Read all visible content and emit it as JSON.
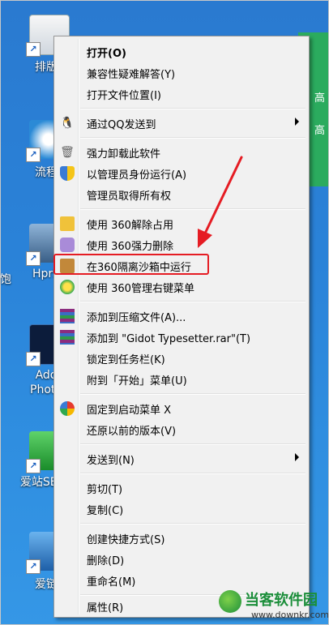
{
  "desktop": {
    "icons": [
      {
        "label": "排版"
      },
      {
        "label": "流程"
      },
      {
        "label": "HprS"
      },
      {
        "label": "Ado Photo"
      },
      {
        "label": "爱站SE 包"
      },
      {
        "label": "爱链"
      }
    ],
    "left_edge_text": "饱",
    "right_panel_text": [
      "高",
      "高"
    ]
  },
  "context_menu": {
    "items": [
      {
        "label": "打开(O)",
        "icon": "",
        "bold": true
      },
      {
        "label": "兼容性疑难解答(Y)",
        "icon": ""
      },
      {
        "label": "打开文件位置(I)",
        "icon": ""
      },
      {
        "label": "通过QQ发送到",
        "icon": "qq-penguin-icon",
        "submenu": true
      },
      {
        "label": "强力卸载此软件",
        "icon": "trash-icon"
      },
      {
        "label": "以管理员身份运行(A)",
        "icon": "uac-shield-icon"
      },
      {
        "label": "管理员取得所有权",
        "icon": ""
      },
      {
        "label": "使用 360解除占用",
        "icon": "360-unlock-icon"
      },
      {
        "label": "使用 360强力删除",
        "icon": "360-delete-icon"
      },
      {
        "label": "在360隔离沙箱中运行",
        "icon": "360-sandbox-icon"
      },
      {
        "label": "使用 360管理右键菜单",
        "icon": "360-menu-icon"
      },
      {
        "label": "添加到压缩文件(A)...",
        "icon": "winrar-icon"
      },
      {
        "label": "添加到 \"Gidot Typesetter.rar\"(T)",
        "icon": "winrar-icon"
      },
      {
        "label": "锁定到任务栏(K)",
        "icon": ""
      },
      {
        "label": "附到「开始」菜单(U)",
        "icon": ""
      },
      {
        "label": "固定到启动菜单 X",
        "icon": "pin-start-icon"
      },
      {
        "label": "还原以前的版本(V)",
        "icon": ""
      },
      {
        "label": "发送到(N)",
        "icon": "",
        "submenu": true
      },
      {
        "label": "剪切(T)",
        "icon": ""
      },
      {
        "label": "复制(C)",
        "icon": ""
      },
      {
        "label": "创建快捷方式(S)",
        "icon": ""
      },
      {
        "label": "删除(D)",
        "icon": ""
      },
      {
        "label": "重命名(M)",
        "icon": ""
      },
      {
        "label": "属性(R)",
        "icon": ""
      }
    ]
  },
  "annotation": {
    "highlight_color": "#e51c23"
  },
  "watermark": {
    "brand": "当客软件园",
    "url": "www.downkr.com"
  }
}
